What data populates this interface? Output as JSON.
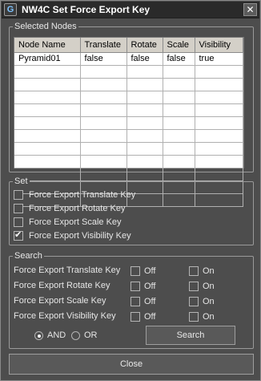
{
  "window": {
    "title": "NW4C Set Force Export Key",
    "app_icon": "G"
  },
  "selected_nodes": {
    "group_label": "Selected Nodes",
    "columns": [
      "Node Name",
      "Translate",
      "Rotate",
      "Scale",
      "Visibility"
    ],
    "rows": [
      [
        "Pyramid01",
        "false",
        "false",
        "false",
        "true"
      ]
    ],
    "empty_rows": 11
  },
  "set": {
    "group_label": "Set",
    "items": [
      {
        "label": "Force Export Translate Key",
        "checked": false
      },
      {
        "label": "Force Export Rotate Key",
        "checked": false
      },
      {
        "label": "Force Export Scale Key",
        "checked": false
      },
      {
        "label": "Force Export Visibility Key",
        "checked": true
      }
    ]
  },
  "search": {
    "group_label": "Search",
    "rows": [
      {
        "label": "Force Export Translate Key",
        "off": "Off",
        "on": "On"
      },
      {
        "label": "Force Export Rotate Key",
        "off": "Off",
        "on": "On"
      },
      {
        "label": "Force Export Scale Key",
        "off": "Off",
        "on": "On"
      },
      {
        "label": "Force Export Visibility Key",
        "off": "Off",
        "on": "On"
      }
    ],
    "and_label": "AND",
    "or_label": "OR",
    "mode": "AND",
    "button_label": "Search"
  },
  "close_label": "Close"
}
